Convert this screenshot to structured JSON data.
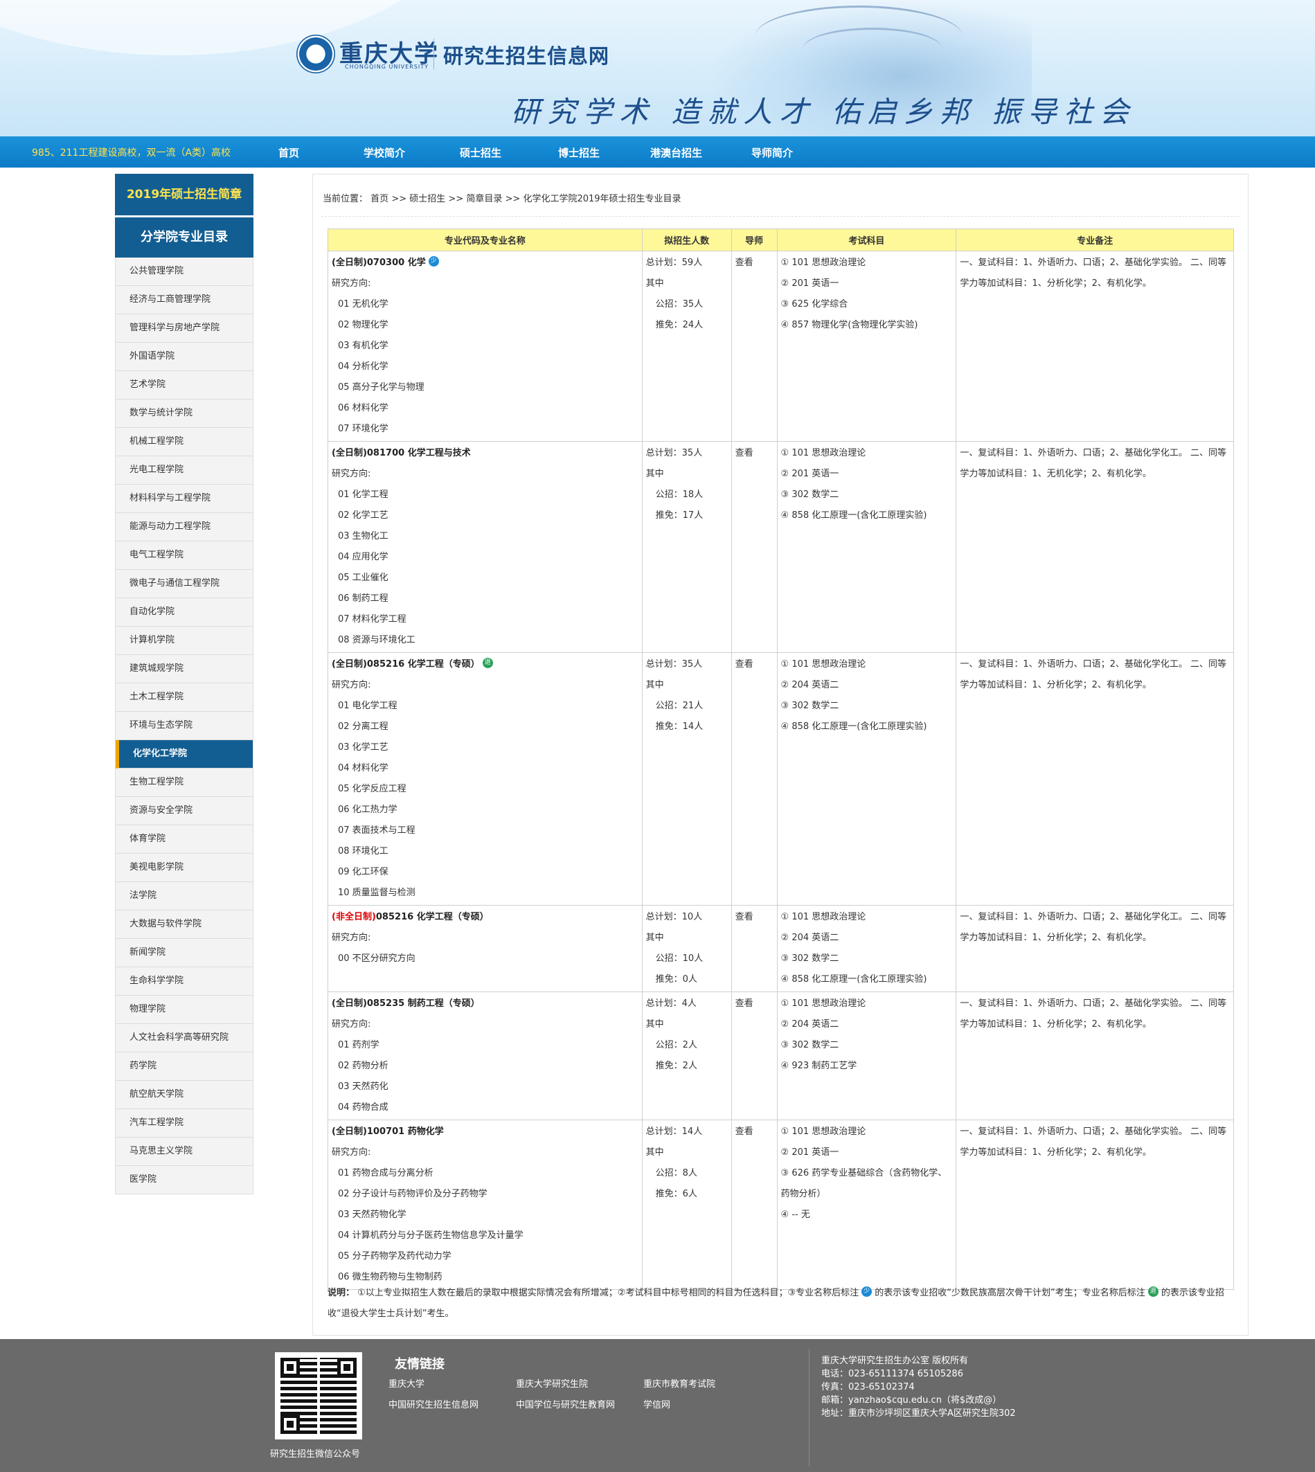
{
  "header": {
    "logo_cn": "重庆大学",
    "logo_en": "CHONGQING UNIVERSITY",
    "site_title": "研究生招生信息网",
    "slogan": "研究学术 造就人才 佑启乡邦 振导社会"
  },
  "nav": {
    "tagline": "985、211工程建设高校，双一流（A类）高校",
    "items": [
      "首页",
      "学校简介",
      "硕士招生",
      "博士招生",
      "港澳台招生",
      "导师简介"
    ]
  },
  "sidebar": {
    "title": "2019年硕士招生简章",
    "subtitle": "分学院专业目录",
    "items": [
      "公共管理学院",
      "经济与工商管理学院",
      "管理科学与房地产学院",
      "外国语学院",
      "艺术学院",
      "数学与统计学院",
      "机械工程学院",
      "光电工程学院",
      "材料科学与工程学院",
      "能源与动力工程学院",
      "电气工程学院",
      "微电子与通信工程学院",
      "自动化学院",
      "计算机学院",
      "建筑城规学院",
      "土木工程学院",
      "环境与生态学院",
      "化学化工学院",
      "生物工程学院",
      "资源与安全学院",
      "体育学院",
      "美视电影学院",
      "法学院",
      "大数据与软件学院",
      "新闻学院",
      "生命科学学院",
      "物理学院",
      "人文社会科学高等研究院",
      "药学院",
      "航空航天学院",
      "汽车工程学院",
      "马克思主义学院",
      "医学院"
    ],
    "active": "化学化工学院"
  },
  "breadcrumb": {
    "label": "当前位置：",
    "home": "首页",
    "sep": ">>",
    "master": "硕士招生",
    "catalog": "简章目录",
    "current": "化学化工学院2019年硕士招生专业目录"
  },
  "table": {
    "headers": [
      "专业代码及专业名称",
      "拟招生人数",
      "导师",
      "考试科目",
      "专业备注"
    ],
    "direction_label": "研究方向:",
    "sub_label": "其中",
    "tutor_link": "查看",
    "rows": [
      {
        "mode": "(全日制)",
        "mode_red": false,
        "code_name": "070300 化学",
        "badge": "少",
        "directions": [
          "01 无机化学",
          "02 物理化学",
          "03 有机化学",
          "04 分析化学",
          "05 高分子化学与物理",
          "06 材料化学",
          "07 环境化学"
        ],
        "total": "总计划：59人",
        "public": "公招：35人",
        "exempt": "推免：24人",
        "subjects": [
          [
            "①",
            "101 思想政治理论"
          ],
          [
            "②",
            "201 英语一"
          ],
          [
            "③",
            "625 化学综合"
          ],
          [
            "④",
            "857 物理化学(含物理化学实验)"
          ]
        ],
        "remark": "一、复试科目：1、外语听力、口语；2、基础化学实验。 二、同等学力等加试科目：1、分析化学；2、有机化学。"
      },
      {
        "mode": "(全日制)",
        "mode_red": false,
        "code_name": "081700 化学工程与技术",
        "badge": "",
        "directions": [
          "01 化学工程",
          "02 化学工艺",
          "03 生物化工",
          "04 应用化学",
          "05 工业催化",
          "06 制药工程",
          "07 材料化学工程",
          "08 资源与环境化工"
        ],
        "total": "总计划：35人",
        "public": "公招：18人",
        "exempt": "推免：17人",
        "subjects": [
          [
            "①",
            "101 思想政治理论"
          ],
          [
            "②",
            "201 英语一"
          ],
          [
            "③",
            "302 数学二"
          ],
          [
            "④",
            "858 化工原理一(含化工原理实验)"
          ]
        ],
        "remark": "一、复试科目：1、外语听力、口语；2、基础化学化工。 二、同等学力等加试科目：1、无机化学；2、有机化学。"
      },
      {
        "mode": "(全日制)",
        "mode_red": false,
        "code_name": "085216 化学工程（专硕）",
        "badge": "退",
        "directions": [
          "01 电化学工程",
          "02 分离工程",
          "03 化学工艺",
          "04 材料化学",
          "05 化学反应工程",
          "06 化工热力学",
          "07 表面技术与工程",
          "08 环境化工",
          "09 化工环保",
          "10 质量监督与检测"
        ],
        "total": "总计划：35人",
        "public": "公招：21人",
        "exempt": "推免：14人",
        "subjects": [
          [
            "①",
            "101 思想政治理论"
          ],
          [
            "②",
            "204 英语二"
          ],
          [
            "③",
            "302 数学二"
          ],
          [
            "④",
            "858 化工原理一(含化工原理实验)"
          ]
        ],
        "remark": "一、复试科目：1、外语听力、口语；2、基础化学化工。 二、同等学力等加试科目：1、分析化学；2、有机化学。"
      },
      {
        "mode": "(非全日制)",
        "mode_red": true,
        "code_name": "085216 化学工程（专硕）",
        "badge": "",
        "directions": [
          "00 不区分研究方向"
        ],
        "total": "总计划：10人",
        "public": "公招：10人",
        "exempt": "推免：0人",
        "subjects": [
          [
            "①",
            "101 思想政治理论"
          ],
          [
            "②",
            "204 英语二"
          ],
          [
            "③",
            "302 数学二"
          ],
          [
            "④",
            "858 化工原理一(含化工原理实验)"
          ]
        ],
        "remark": "一、复试科目：1、外语听力、口语；2、基础化学化工。 二、同等学力等加试科目：1、分析化学；2、有机化学。"
      },
      {
        "mode": "(全日制)",
        "mode_red": false,
        "code_name": "085235 制药工程（专硕）",
        "badge": "",
        "directions": [
          "01 药剂学",
          "02 药物分析",
          "03 天然药化",
          "04 药物合成"
        ],
        "total": "总计划：4人",
        "public": "公招：2人",
        "exempt": "推免：2人",
        "subjects": [
          [
            "①",
            "101 思想政治理论"
          ],
          [
            "②",
            "204 英语二"
          ],
          [
            "③",
            "302 数学二"
          ],
          [
            "④",
            "923 制药工艺学"
          ]
        ],
        "remark": "一、复试科目：1、外语听力、口语；2、基础化学实验。 二、同等学力等加试科目：1、分析化学；2、有机化学。"
      },
      {
        "mode": "(全日制)",
        "mode_red": false,
        "code_name": "100701 药物化学",
        "badge": "",
        "directions": [
          "01 药物合成与分离分析",
          "02 分子设计与药物评价及分子药物学",
          "03 天然药物化学",
          "04 计算机药分与分子医药生物信息学及计量学",
          "05 分子药物学及药代动力学",
          "06 微生物药物与生物制药"
        ],
        "total": "总计划：14人",
        "public": "公招：8人",
        "exempt": "推免：6人",
        "subjects": [
          [
            "①",
            "101 思想政治理论"
          ],
          [
            "②",
            "201 英语一"
          ],
          [
            "③",
            "626 药学专业基础综合（含药物化学、药物分析）"
          ],
          [
            "④",
            "-- 无"
          ]
        ],
        "remark": "一、复试科目：1、外语听力、口语；2、基础化学实验。 二、同等学力等加试科目：1、分析化学；2、有机化学。"
      }
    ]
  },
  "note": {
    "label": "说明：",
    "text1": "①以上专业拟招生人数在最后的录取中根据实际情况会有所增减；②考试科目中标号相同的科目为任选科目；③专业名称后标注",
    "text2": "的表示该专业招收“少数民族高层次骨干计划”考生；专业名称后标注",
    "text3": "的表示该专业招收“退役大学生士兵计划”考生。",
    "badge1": "少",
    "badge2": "退"
  },
  "footer": {
    "qr_caption": "研究生招生微信公众号",
    "links_title": "友情链接",
    "links": [
      "重庆大学",
      "重庆大学研究生院",
      "重庆市教育考试院",
      "中国研究生招生信息网",
      "中国学位与研究生教育网",
      "学信网"
    ],
    "contact": [
      "重庆大学研究生招生办公室 版权所有",
      "电话：023-65111374 65105286",
      "传真：023-65102374",
      "邮箱：yanzhao$cqu.edu.cn（将$改成@）",
      "地址：重庆市沙坪坝区重庆大学A区研究生院302"
    ]
  },
  "colors": {
    "nav_blue": "#0d7bc7",
    "sidebar_blue": "#125e92",
    "accent_yellow": "#ffe44d",
    "header_yellow": "#fff899",
    "footer_gray": "#6a6a6a"
  }
}
